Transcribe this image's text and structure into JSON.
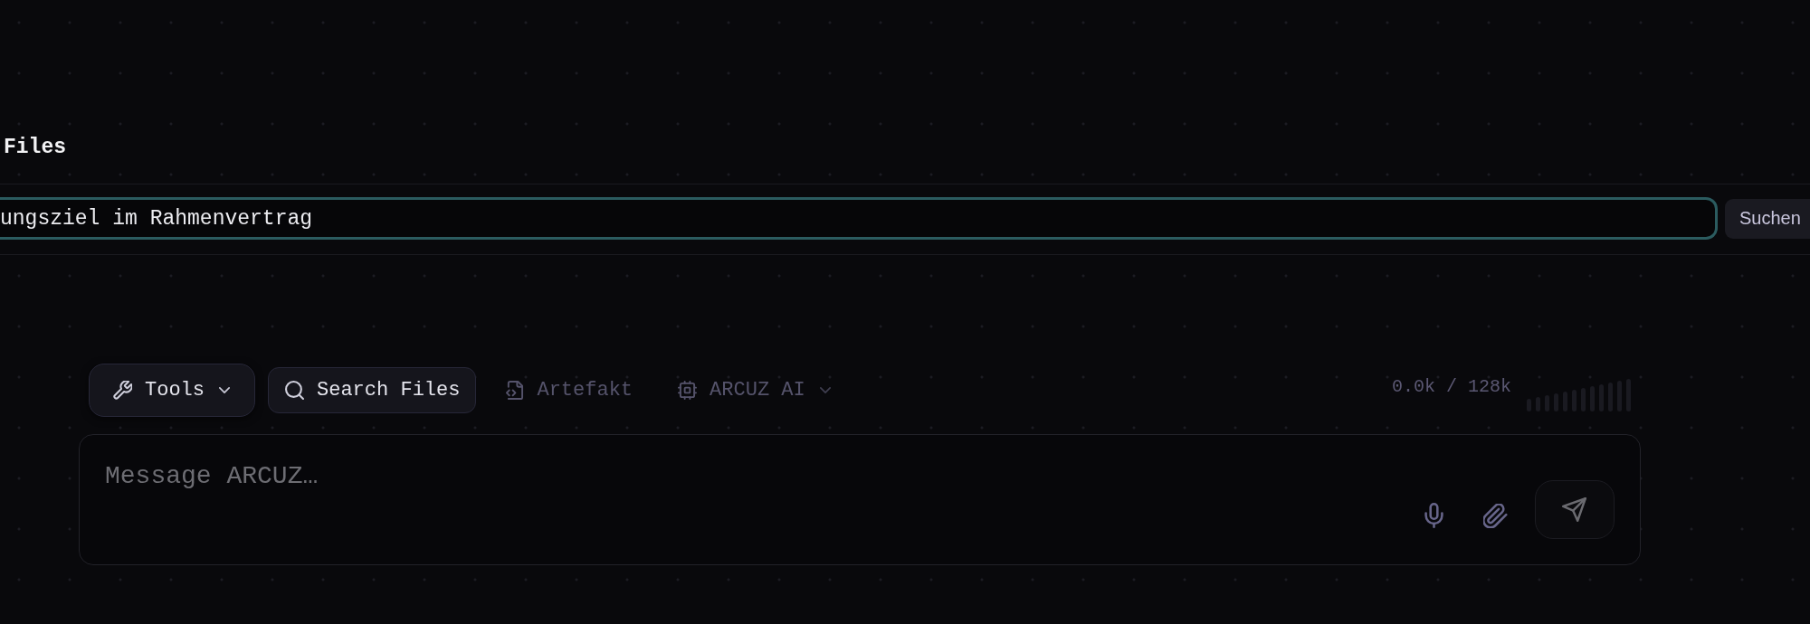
{
  "panel": {
    "title": "Files"
  },
  "search": {
    "value": "ungsziel im Rahmenvertrag",
    "focused": true,
    "button": "Suchen"
  },
  "toolbar": [
    {
      "kind": "menu",
      "label": "Tools",
      "active": true
    },
    {
      "kind": "toggle",
      "label": "Search Files",
      "active": true
    },
    {
      "kind": "toggle",
      "label": "Artefakt",
      "active": false
    },
    {
      "kind": "menu",
      "label": "ARCUZ AI",
      "active": false
    }
  ],
  "context": {
    "reading": "0.0k / 128k"
  },
  "composer": {
    "placeholder": "Message ARCUZ…",
    "send_disabled": true
  }
}
